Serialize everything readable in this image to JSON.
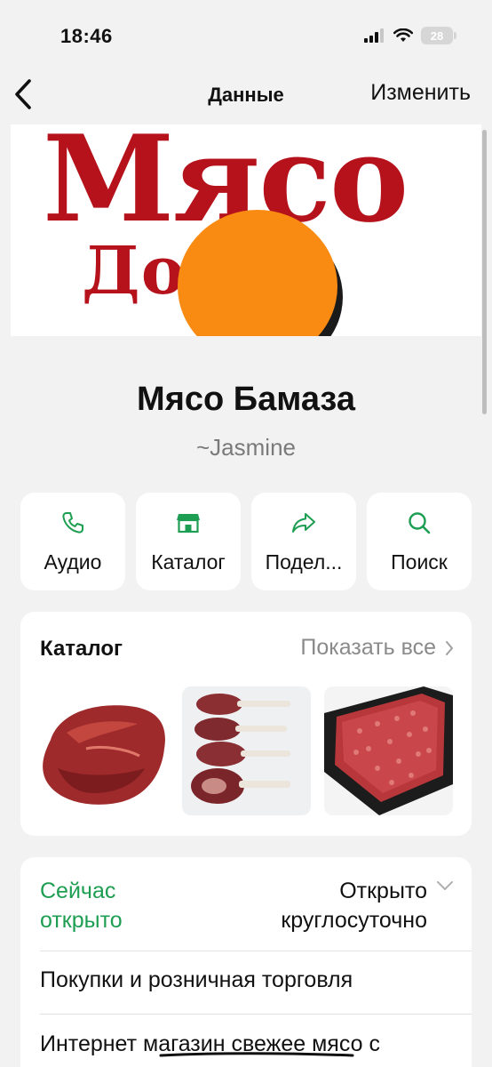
{
  "status_bar": {
    "time": "18:46",
    "battery": "28"
  },
  "nav": {
    "title": "Данные",
    "edit_label": "Изменить"
  },
  "header_image": {
    "logo_line1": "Мясо",
    "logo_line2": "До   ка",
    "accent_color": "#b5121b",
    "privacy_mask_color": "#f98a12"
  },
  "profile": {
    "name": "Мясо Бамаза",
    "subtitle": "~Jasmine"
  },
  "actions": [
    {
      "label": "Аудио",
      "icon": "phone-icon"
    },
    {
      "label": "Каталог",
      "icon": "storefront-icon"
    },
    {
      "label": "Подел...",
      "icon": "share-arrow-icon"
    },
    {
      "label": "Поиск",
      "icon": "search-icon"
    }
  ],
  "catalog": {
    "title": "Каталог",
    "show_all": "Показать все",
    "items": [
      {
        "icon": "raw-beef-cut-image"
      },
      {
        "icon": "lamb-rack-chops-image"
      },
      {
        "icon": "minced-meat-tray-image"
      }
    ]
  },
  "info": {
    "open_now": "Сейчас открыто",
    "hours": "Открыто круглосуточно",
    "category": "Покупки и розничная торговля",
    "description": "Интернет магазин свежее мясо с"
  },
  "colors": {
    "accent_green": "#1e9e52",
    "background": "#f2f2f2"
  }
}
